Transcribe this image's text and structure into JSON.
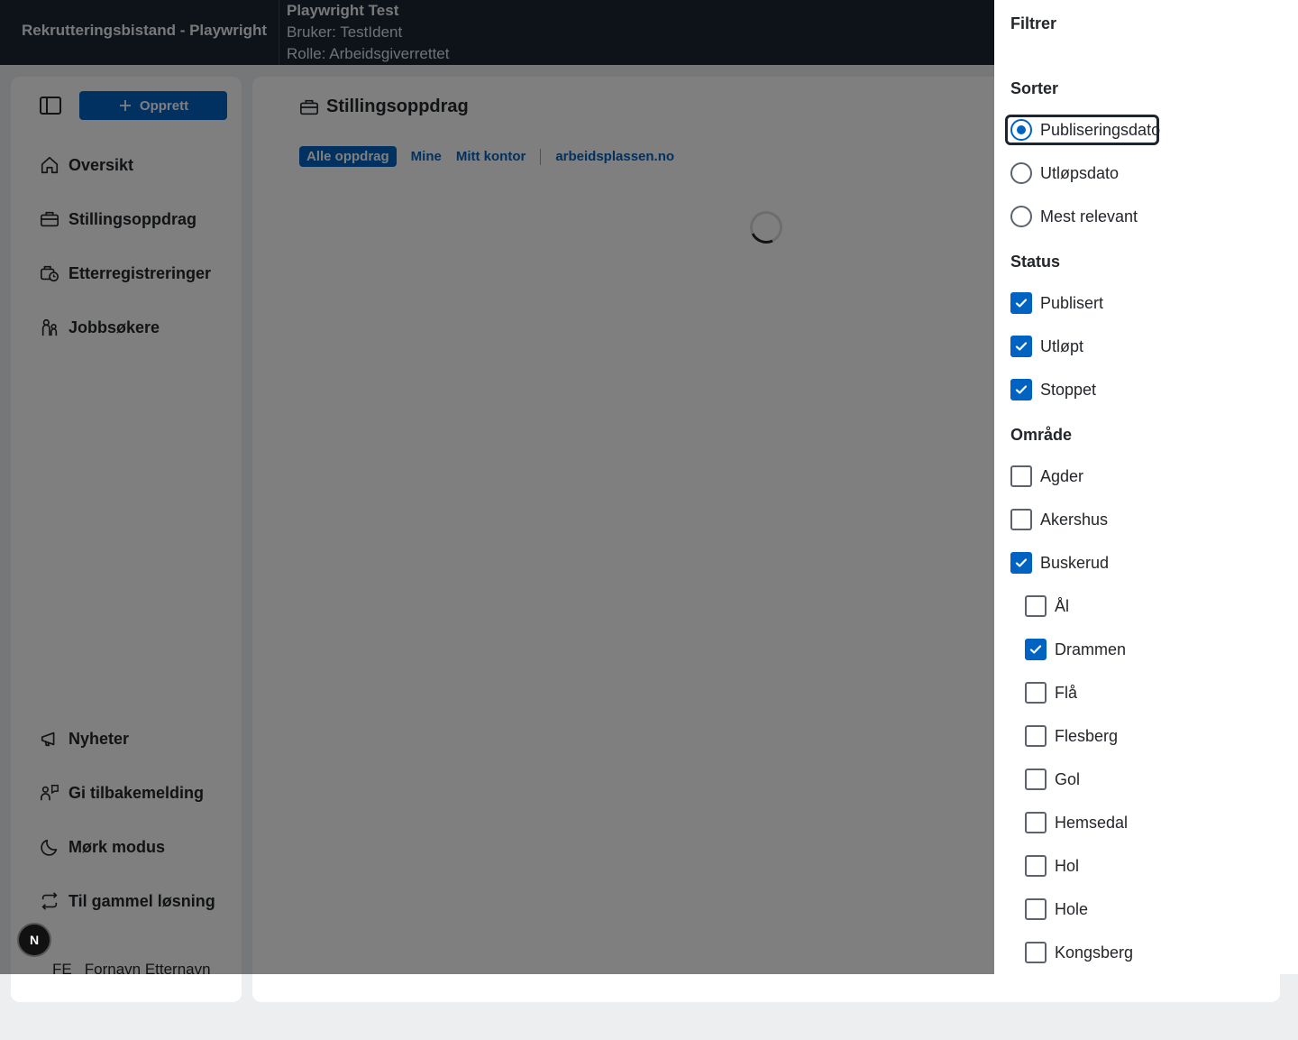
{
  "topbar": {
    "app_title": "Rekrutteringsbistand - Playwright",
    "env_name": "Playwright Test",
    "user_line": "Bruker: TestIdent",
    "role_line": "Rolle: Arbeidsgiverrettet"
  },
  "sidebar": {
    "create_label": "Opprett",
    "nav": [
      {
        "label": "Oversikt",
        "icon": "home-icon"
      },
      {
        "label": "Stillingsoppdrag",
        "icon": "briefcase-icon"
      },
      {
        "label": "Etterregistreringer",
        "icon": "briefcase-clock-icon"
      },
      {
        "label": "Jobbsøkere",
        "icon": "people-icon"
      }
    ],
    "footer_nav": [
      {
        "label": "Nyheter",
        "icon": "megaphone-icon"
      },
      {
        "label": "Gi tilbakemelding",
        "icon": "feedback-icon"
      },
      {
        "label": "Mørk modus",
        "icon": "moon-icon"
      },
      {
        "label": "Til gammel løsning",
        "icon": "arrows-swap-icon"
      }
    ],
    "user_initials": "FE",
    "user_name": "Fornavn Etternavn",
    "badge_letter": "N"
  },
  "main": {
    "title": "Stillingsoppdrag",
    "tabs": [
      "Alle oppdrag",
      "Mine",
      "Mitt kontor",
      "arbeidsplassen.no"
    ],
    "active_tab": "Alle oppdrag"
  },
  "filter": {
    "title": "Filtrer",
    "sort_heading": "Sorter",
    "sort_options": [
      {
        "label": "Publiseringsdato",
        "checked": true
      },
      {
        "label": "Utløpsdato",
        "checked": false
      },
      {
        "label": "Mest relevant",
        "checked": false
      }
    ],
    "status_heading": "Status",
    "status_options": [
      {
        "label": "Publisert",
        "checked": true
      },
      {
        "label": "Utløpt",
        "checked": true
      },
      {
        "label": "Stoppet",
        "checked": true
      }
    ],
    "area_heading": "Område",
    "area_options": [
      {
        "label": "Agder",
        "checked": false
      },
      {
        "label": "Akershus",
        "checked": false
      },
      {
        "label": "Buskerud",
        "checked": true
      }
    ],
    "sub_area_options": [
      {
        "label": "Ål",
        "checked": false
      },
      {
        "label": "Drammen",
        "checked": true
      },
      {
        "label": "Flå",
        "checked": false
      },
      {
        "label": "Flesberg",
        "checked": false
      },
      {
        "label": "Gol",
        "checked": false
      },
      {
        "label": "Hemsedal",
        "checked": false
      },
      {
        "label": "Hol",
        "checked": false
      },
      {
        "label": "Hole",
        "checked": false
      },
      {
        "label": "Kongsberg",
        "checked": false
      }
    ]
  },
  "colors": {
    "accent": "#0063c1",
    "topbar_bg": "#1d2533"
  }
}
